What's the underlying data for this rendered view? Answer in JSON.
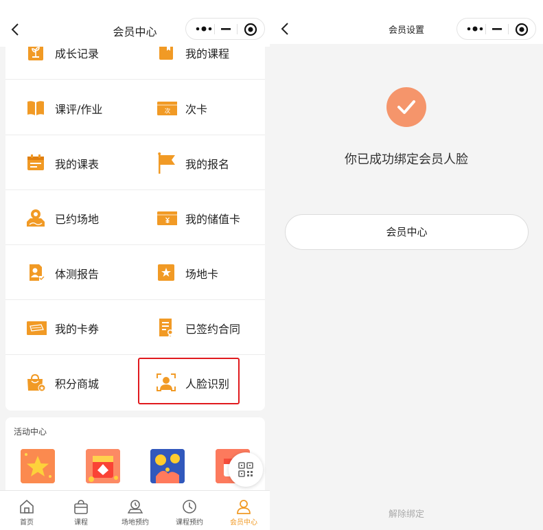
{
  "left": {
    "nav_title": "会员中心",
    "menu_rows": [
      [
        {
          "label": "成长记录",
          "icon": "growth-record-icon"
        },
        {
          "label": "我的课程",
          "icon": "my-course-icon"
        }
      ],
      [
        {
          "label": "课评/作业",
          "icon": "book-icon"
        },
        {
          "label": "次卡",
          "icon": "count-card-icon"
        }
      ],
      [
        {
          "label": "我的课表",
          "icon": "schedule-icon"
        },
        {
          "label": "我的报名",
          "icon": "flag-icon"
        }
      ],
      [
        {
          "label": "已约场地",
          "icon": "venue-map-icon"
        },
        {
          "label": "我的储值卡",
          "icon": "stored-value-card-icon"
        }
      ],
      [
        {
          "label": "体测报告",
          "icon": "fitness-report-icon"
        },
        {
          "label": "场地卡",
          "icon": "venue-card-icon"
        }
      ],
      [
        {
          "label": "我的卡券",
          "icon": "coupon-icon"
        },
        {
          "label": "已签约合同",
          "icon": "contract-icon"
        }
      ],
      [
        {
          "label": "积分商城",
          "icon": "points-mall-icon"
        },
        {
          "label": "人脸识别",
          "icon": "face-recognition-icon"
        }
      ]
    ],
    "count_card_char": "次",
    "activity": {
      "title": "活动中心"
    },
    "tabs": [
      {
        "label": "首页",
        "icon": "home-icon"
      },
      {
        "label": "课程",
        "icon": "course-bag-icon"
      },
      {
        "label": "场地预约",
        "icon": "venue-booking-icon"
      },
      {
        "label": "课程预约",
        "icon": "clock-icon"
      },
      {
        "label": "会员中心",
        "icon": "member-icon",
        "active": true
      }
    ]
  },
  "right": {
    "nav_title": "会员设置",
    "success_text": "你已成功绑定会员人脸",
    "member_center_button": "会员中心",
    "unbind_text": "解除绑定"
  },
  "colors": {
    "accent": "#f19a25",
    "success": "#f5956b",
    "highlight": "#e0191d"
  }
}
